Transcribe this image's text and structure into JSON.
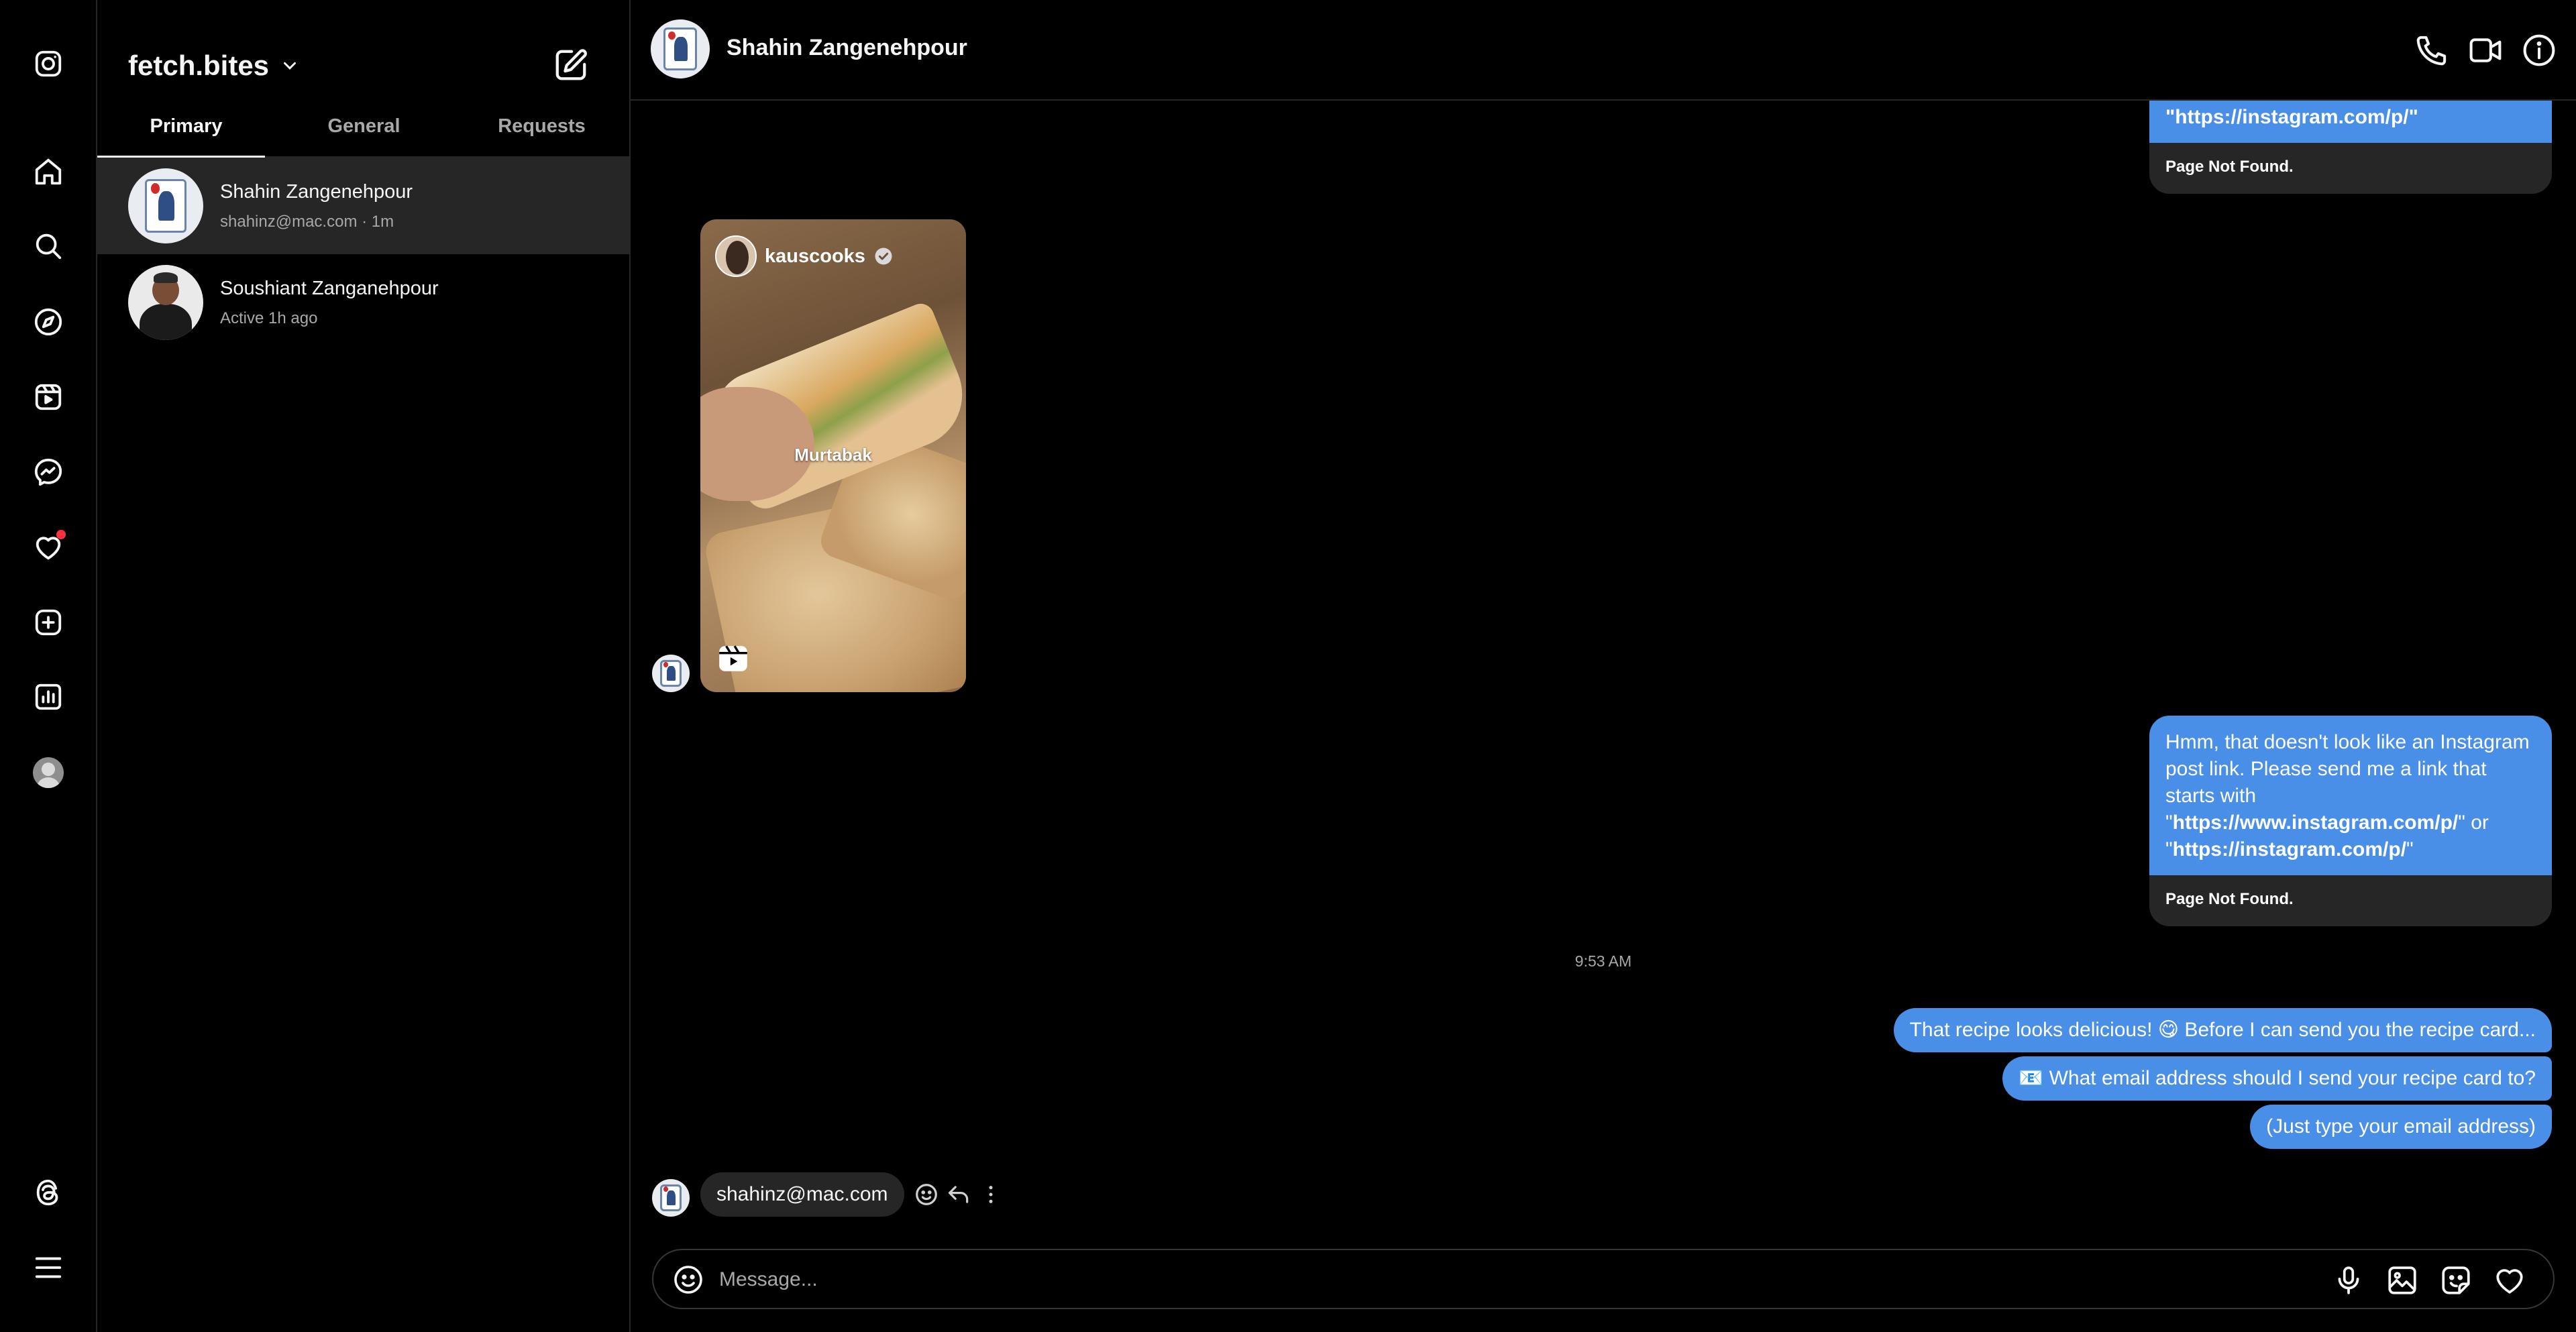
{
  "account": {
    "name": "fetch.bites"
  },
  "tabs": [
    "Primary",
    "General",
    "Requests"
  ],
  "threads": [
    {
      "name": "Shahin Zangenehpour",
      "sub": "shahinz@mac.com · 1m"
    },
    {
      "name": "Soushiant Zanganehpour",
      "sub": "Active 1h ago"
    }
  ],
  "chat": {
    "title": "Shahin Zangenehpour",
    "top_card": {
      "line": "\"https://instagram.com/p/\"",
      "footer": "Page Not Found."
    },
    "reel": {
      "owner": "kauscooks",
      "caption": "Murtabak"
    },
    "card2": {
      "text1": "Hmm, that doesn't look like an Instagram post link. Please send me a link that starts with \"",
      "link1": "https://www.instagram.com/p/",
      "text2": "\" or \"",
      "link2": "https://instagram.com/p/",
      "text3": "\"",
      "footer": "Page Not Found."
    },
    "timestamp": "9:53 AM",
    "outgoing": [
      "That recipe looks delicious! 😋 Before I can send you the recipe card...",
      "📧 What email address should I send your recipe card to?",
      "(Just type your email address)"
    ],
    "incoming_reply": "shahinz@mac.com",
    "composer_placeholder": "Message..."
  },
  "colors": {
    "outgoing_bubble": "#4a8fe7",
    "incoming_bubble": "#262626",
    "notification": "#ff3040"
  }
}
